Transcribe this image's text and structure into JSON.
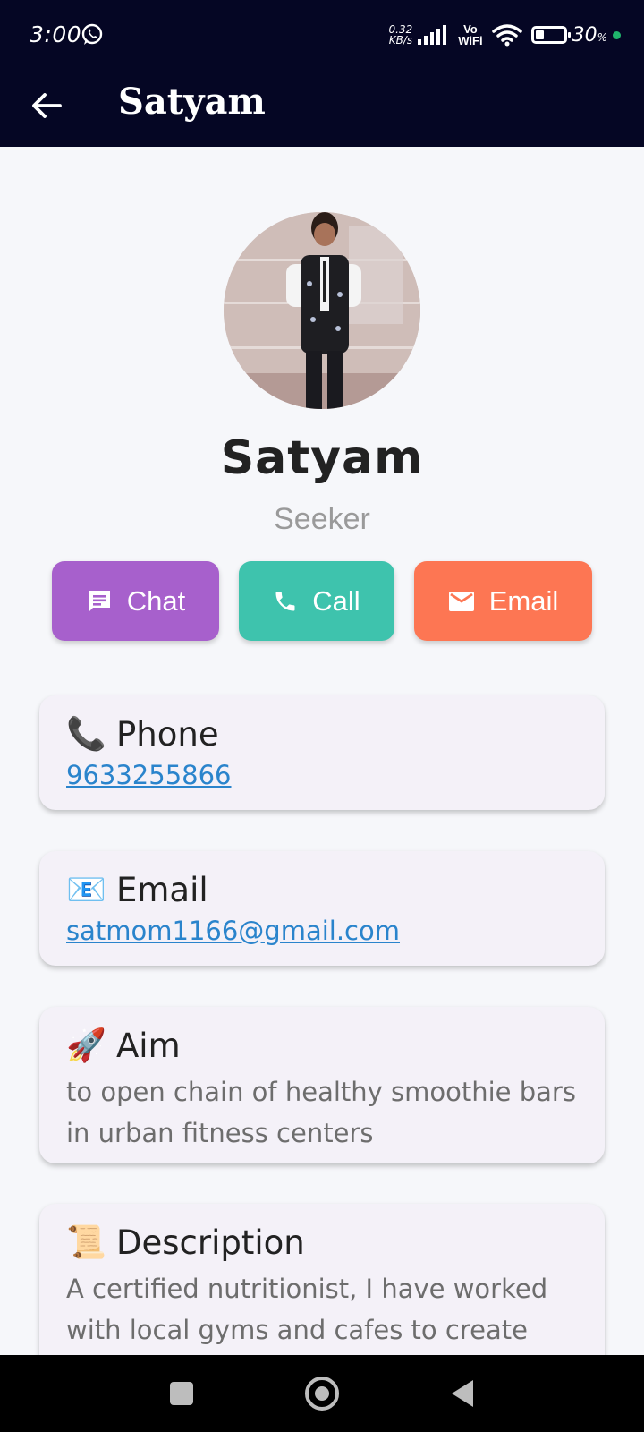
{
  "status_bar": {
    "time": "3:00",
    "net_speed_value": "0.32",
    "net_speed_unit": "KB/s",
    "vowifi_top": "Vo",
    "vowifi_bottom": "WiFi",
    "battery_percent": "30",
    "battery_suffix": "%",
    "battery_level": 0.3,
    "icons": [
      "whatsapp-icon",
      "signal-icon",
      "wifi-icon",
      "battery-icon"
    ]
  },
  "app_bar": {
    "title": "Satyam",
    "back_icon": "arrow-left-icon"
  },
  "profile": {
    "name": "Satyam",
    "role": "Seeker",
    "avatar": "profile-photo"
  },
  "actions": {
    "chat_label": "Chat",
    "call_label": "Call",
    "email_label": "Email",
    "colors": {
      "chat": "#a760cc",
      "call": "#3ec3ad",
      "email": "#fd7653"
    }
  },
  "cards": {
    "phone": {
      "emoji": "📞",
      "title": "Phone",
      "value": "9633255866"
    },
    "email": {
      "emoji": "📧",
      "title": "Email",
      "value": "satmom1166@gmail.com"
    },
    "aim": {
      "emoji": "🚀",
      "title": "Aim",
      "value": "to open chain of healthy smoothie bars in urban fitness centers"
    },
    "description": {
      "emoji": "📜",
      "title": "Description",
      "value": "A certified nutritionist, I have worked with local gyms and cafes to create"
    }
  },
  "nav_bar": {
    "icons": [
      "recent-apps-icon",
      "home-icon",
      "back-icon"
    ]
  },
  "colors": {
    "header_bg": "#050624",
    "link": "#2a84cc",
    "card_bg": "#f4f1f8"
  }
}
